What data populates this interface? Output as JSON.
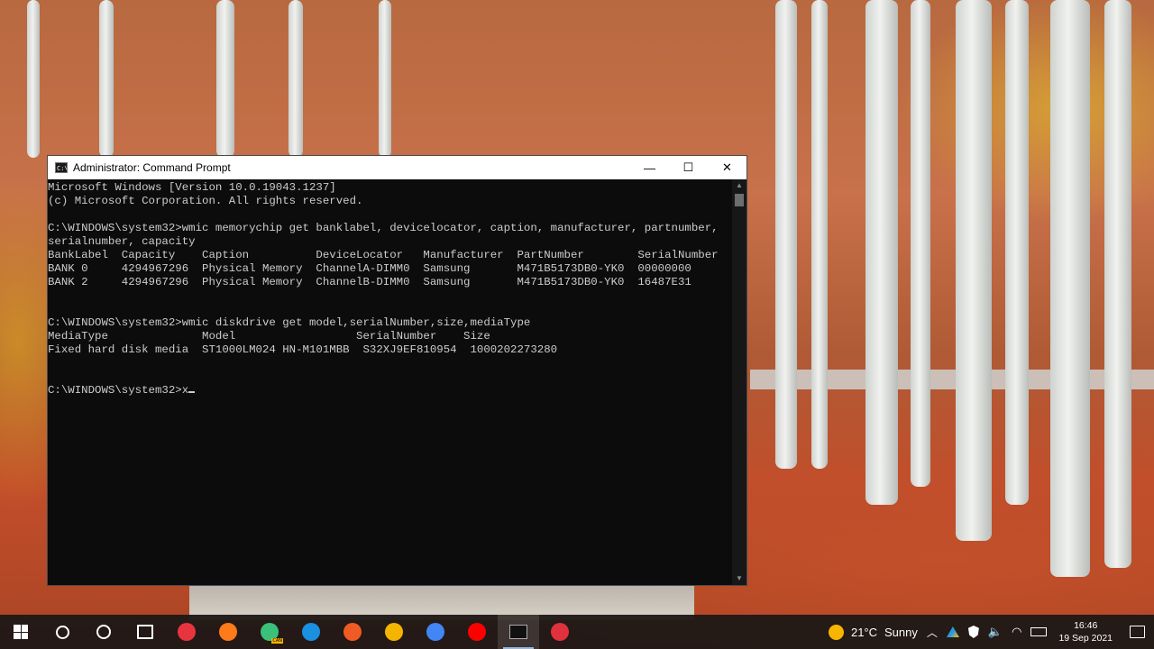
{
  "window": {
    "title": "Administrator: Command Prompt",
    "icon_label": "C:\\",
    "minimize_glyph": "—",
    "maximize_glyph": "☐",
    "close_glyph": "✕"
  },
  "console": {
    "lines": [
      "Microsoft Windows [Version 10.0.19043.1237]",
      "(c) Microsoft Corporation. All rights reserved.",
      "",
      "C:\\WINDOWS\\system32>wmic memorychip get banklabel, devicelocator, caption, manufacturer, partnumber,",
      "serialnumber, capacity",
      "BankLabel  Capacity    Caption          DeviceLocator   Manufacturer  PartNumber        SerialNumber",
      "BANK 0     4294967296  Physical Memory  ChannelA-DIMM0  Samsung       M471B5173DB0-YK0  00000000",
      "BANK 2     4294967296  Physical Memory  ChannelB-DIMM0  Samsung       M471B5173DB0-YK0  16487E31",
      "",
      "",
      "C:\\WINDOWS\\system32>wmic diskdrive get model,serialNumber,size,mediaType",
      "MediaType              Model                  SerialNumber    Size",
      "Fixed hard disk media  ST1000LM024 HN-M101MBB  S32XJ9EF810954  1000202273280",
      "",
      "",
      "C:\\WINDOWS\\system32>x"
    ]
  },
  "taskbar": {
    "apps": [
      {
        "name": "start",
        "icon": "windows-logo-icon"
      },
      {
        "name": "search",
        "icon": "search-icon"
      },
      {
        "name": "cortana",
        "icon": "cortana-circle-icon"
      },
      {
        "name": "task-view",
        "icon": "task-view-icon"
      },
      {
        "name": "vivaldi",
        "icon": "vivaldi-icon",
        "color": "#e8343f"
      },
      {
        "name": "firefox",
        "icon": "firefox-icon",
        "color": "#ff7a1a"
      },
      {
        "name": "edge-canary",
        "icon": "edge-canary-icon",
        "color": "#3ac07a",
        "badge": "CAN"
      },
      {
        "name": "edge",
        "icon": "edge-icon",
        "color": "#1b8fe0"
      },
      {
        "name": "brave",
        "icon": "brave-icon",
        "color": "#f05a24"
      },
      {
        "name": "chrome-canary",
        "icon": "chrome-canary-icon",
        "color": "#f4b400"
      },
      {
        "name": "chrome",
        "icon": "chrome-icon",
        "color": "#4285f4"
      },
      {
        "name": "youtube-music",
        "icon": "youtube-music-icon",
        "color": "#ff0000"
      },
      {
        "name": "command-prompt",
        "icon": "command-prompt-icon",
        "active": true
      },
      {
        "name": "recorder",
        "icon": "record-icon",
        "color": "#e0313d"
      }
    ],
    "weather": {
      "temp": "21°C",
      "condition": "Sunny",
      "sun_color": "#f7b500"
    },
    "clock": {
      "time": "16:46",
      "date": "19 Sep 2021"
    }
  }
}
